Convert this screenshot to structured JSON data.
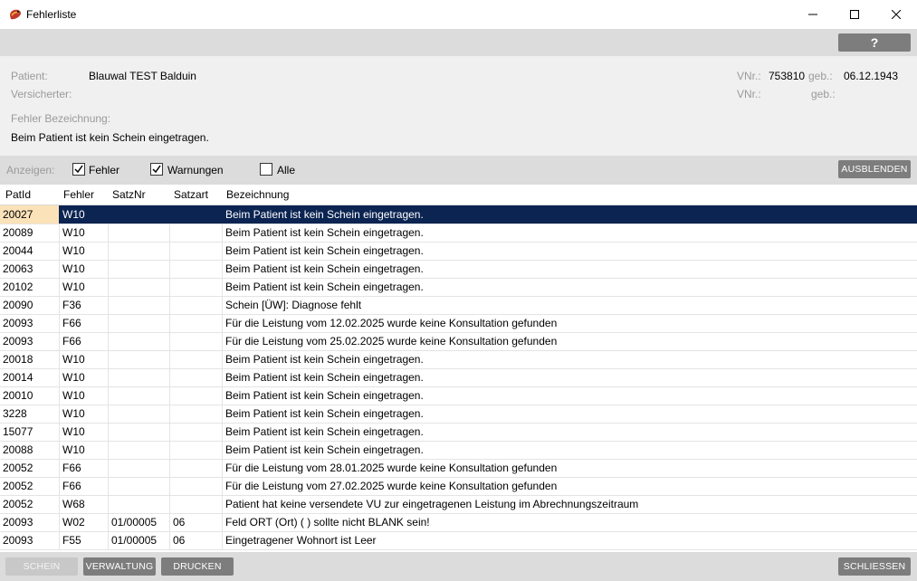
{
  "window": {
    "title": "Fehlerliste",
    "controls": [
      "minimize",
      "maximize",
      "close"
    ]
  },
  "toolbar": {
    "help_label": "?"
  },
  "patient": {
    "patient_label": "Patient:",
    "patient_name": "Blauwal TEST Balduin",
    "versicherter_label": "Versicherter:",
    "vnr_label": "VNr.:",
    "vnr_value": "753810",
    "geb_label": "geb.:",
    "geb_value": "06.12.1943",
    "vnr2_label": "VNr.:",
    "geb2_label": "geb.:",
    "fehler_bezeichnung_label": "Fehler Bezeichnung:",
    "fehler_bezeichnung_text": "Beim Patient ist kein Schein eingetragen."
  },
  "filter": {
    "anzeigen_label": "Anzeigen:",
    "options": [
      {
        "label": "Fehler",
        "checked": true
      },
      {
        "label": "Warnungen",
        "checked": true
      },
      {
        "label": "Alle",
        "checked": false
      }
    ],
    "ausblenden_label": "AUSBLENDEN"
  },
  "table": {
    "columns": [
      "PatId",
      "Fehler",
      "SatzNr",
      "Satzart",
      "Bezeichnung"
    ],
    "selected_index": 0,
    "rows": [
      [
        "20027",
        "W10",
        "",
        "",
        "Beim Patient ist kein Schein eingetragen."
      ],
      [
        "20089",
        "W10",
        "",
        "",
        "Beim Patient ist kein Schein eingetragen."
      ],
      [
        "20044",
        "W10",
        "",
        "",
        "Beim Patient ist kein Schein eingetragen."
      ],
      [
        "20063",
        "W10",
        "",
        "",
        "Beim Patient ist kein Schein eingetragen."
      ],
      [
        "20102",
        "W10",
        "",
        "",
        "Beim Patient ist kein Schein eingetragen."
      ],
      [
        "20090",
        "F36",
        "",
        "",
        "Schein [ÜW]: Diagnose fehlt"
      ],
      [
        "20093",
        "F66",
        "",
        "",
        "Für die Leistung vom 12.02.2025 wurde keine Konsultation gefunden"
      ],
      [
        "20093",
        "F66",
        "",
        "",
        "Für die Leistung vom 25.02.2025 wurde keine Konsultation gefunden"
      ],
      [
        "20018",
        "W10",
        "",
        "",
        "Beim Patient ist kein Schein eingetragen."
      ],
      [
        "20014",
        "W10",
        "",
        "",
        "Beim Patient ist kein Schein eingetragen."
      ],
      [
        "20010",
        "W10",
        "",
        "",
        "Beim Patient ist kein Schein eingetragen."
      ],
      [
        "3228",
        "W10",
        "",
        "",
        "Beim Patient ist kein Schein eingetragen."
      ],
      [
        "15077",
        "W10",
        "",
        "",
        "Beim Patient ist kein Schein eingetragen."
      ],
      [
        "20088",
        "W10",
        "",
        "",
        "Beim Patient ist kein Schein eingetragen."
      ],
      [
        "20052",
        "F66",
        "",
        "",
        "Für die Leistung vom 28.01.2025 wurde keine Konsultation gefunden"
      ],
      [
        "20052",
        "F66",
        "",
        "",
        "Für die Leistung vom 27.02.2025 wurde keine Konsultation gefunden"
      ],
      [
        "20052",
        "W68",
        "",
        "",
        "Patient hat keine versendete VU zur eingetragenen Leistung im Abrechnungszeitraum"
      ],
      [
        "20093",
        "W02",
        "01/00005",
        "06",
        "Feld ORT (Ort) (                       ) sollte nicht BLANK sein!"
      ],
      [
        "20093",
        "F55",
        "01/00005",
        "06",
        "Eingetragener Wohnort ist Leer"
      ]
    ]
  },
  "bottom": {
    "schein_label": "SCHEIN",
    "verwaltung_label": "VERWALTUNG",
    "drucken_label": "DRUCKEN",
    "schliessen_label": "SCHLIESSEN"
  },
  "colors": {
    "selected_row": "#0b2452",
    "selected_cell": "#fbe2b8",
    "button_gray": "#7d7d7d"
  }
}
